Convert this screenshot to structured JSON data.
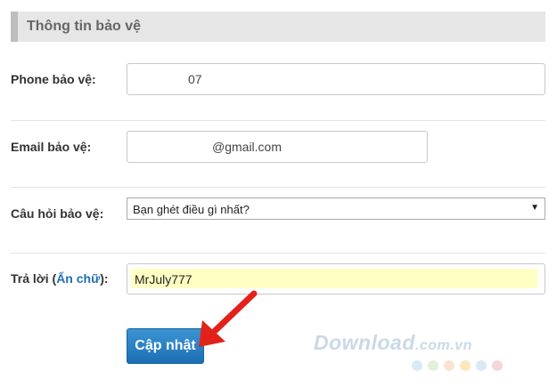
{
  "section": {
    "title": "Thông tin bảo vệ"
  },
  "form": {
    "phone": {
      "label": "Phone bảo vệ:",
      "value": "07"
    },
    "email": {
      "label": "Email bảo vệ:",
      "value": "@gmail.com"
    },
    "question": {
      "label": "Câu hỏi bảo vệ:",
      "selected": "Bạn ghét điều gì nhất?"
    },
    "answer": {
      "label_prefix": "Trả lời (",
      "label_link": "Ẩn chữ",
      "label_suffix": "):",
      "value": "MrJuly777"
    },
    "submit_label": "Cập nhật"
  },
  "watermark": {
    "brand": "Download",
    "suffix": ".com.vn"
  },
  "colors": {
    "accent": "#1f6fb5",
    "button": "#2a82c6",
    "arrow": "#e3211b",
    "answer_highlight": "#ffffc4",
    "watermark_dots": [
      "#d6eaf8",
      "#e3f0d9",
      "#f9e3d3",
      "#fde8b8",
      "#dbe8f5",
      "#f5d6da"
    ]
  }
}
